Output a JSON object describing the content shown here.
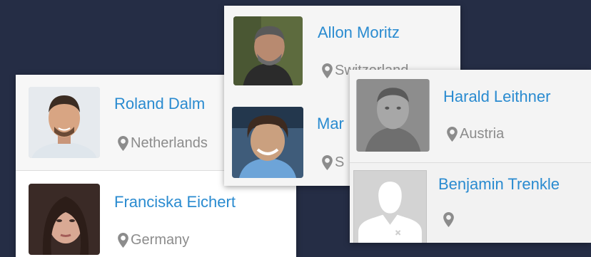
{
  "icons": {
    "location": "map-marker-icon",
    "placeholder": "user-silhouette-icon"
  },
  "colors": {
    "background": "#252d45",
    "name_link": "#2a8bd0",
    "location_text": "#8c8c8c"
  },
  "cards": {
    "left": {
      "people": [
        {
          "name": "Roland Dalm",
          "location": "Netherlands"
        },
        {
          "name": "Franciska Eichert",
          "location": "Germany"
        }
      ]
    },
    "middle": {
      "people": [
        {
          "name": "Allon Moritz",
          "location": "Switzerland"
        },
        {
          "name": "Mar",
          "location": "S"
        }
      ]
    },
    "right": {
      "people": [
        {
          "name": "Harald Leithner",
          "location": "Austria"
        },
        {
          "name": "Benjamin Trenkle",
          "location": ""
        }
      ]
    }
  }
}
